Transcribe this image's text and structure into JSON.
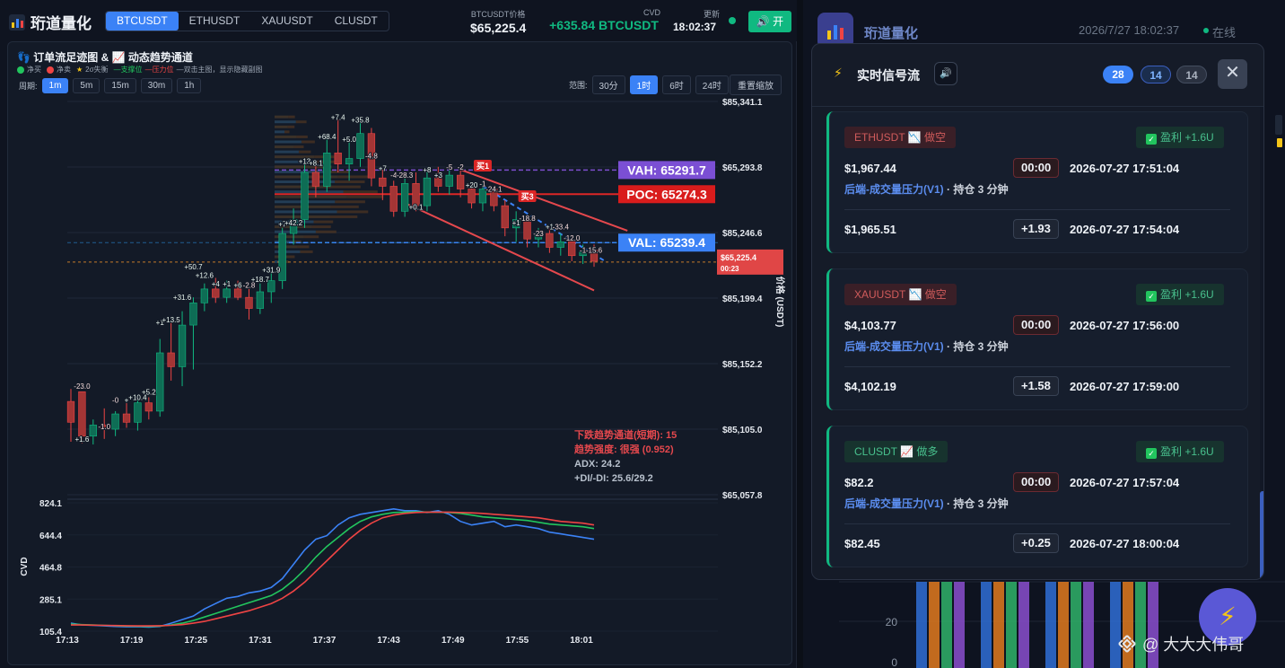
{
  "app": {
    "brand": "珩道量化",
    "symbols": [
      "BTCUSDT",
      "ETHUSDT",
      "XAUUSDT",
      "CLUSDT"
    ],
    "active_symbol": "BTCUSDT",
    "header": {
      "price_label": "BTCUSDT价格",
      "price": "$65,225.4",
      "cvd_label": "CVD",
      "cvd": "+635.84 BTCUSDT",
      "update_label": "更新",
      "update_time": "18:02:37",
      "open_label": "开"
    }
  },
  "chart_panel": {
    "title": "订单流足迹图 & 📈 动态趋势通道",
    "legend": {
      "buy": "净买",
      "sell": "净卖",
      "imbalance": "2σ失衡",
      "support": "—支撑位",
      "resistance": "—压力位",
      "hint": "—双击主图，显示隐藏副图"
    },
    "period_label": "周期:",
    "periods": [
      "1m",
      "5m",
      "15m",
      "30m",
      "1h"
    ],
    "active_period": "1m",
    "range_label": "范围:",
    "ranges": [
      "30分",
      "1时",
      "6时",
      "24时"
    ],
    "active_range": "1时",
    "reset_label": "重置缩放",
    "trend_info": {
      "line1": "下跌趋势通道(短期): 15",
      "line2": "趋势强度: 很强 (0.952)",
      "line3": "ADX: 24.2",
      "line4": "+DI/-DI: 25.6/29.2"
    }
  },
  "chart_data": [
    {
      "type": "candlestick",
      "title": "订单流足迹图",
      "ylabel": "价格 (USDT)",
      "ylim": [
        65057.8,
        65341.1
      ],
      "y_ticks": [
        "$85,341.1",
        "$65,293.8",
        "$85,246.6",
        "$85,199.4",
        "$85,152.2",
        "$85,105.0",
        "$65,057.8"
      ],
      "levels": {
        "vah": {
          "label": "VAH: 65291.7",
          "value": 65291.7,
          "color": "#7c4dcc"
        },
        "poc": {
          "label": "POC: 65274.3",
          "value": 65274.3,
          "color": "#dc2626"
        },
        "val": {
          "label": "VAL: 65239.4",
          "value": 65239.4,
          "color": "#3b82f6"
        },
        "last": {
          "label": "$65,225.4",
          "sublabel": "00:23",
          "value": 65225.4,
          "color": "#ef4444"
        }
      },
      "signals": [
        {
          "label": "买1",
          "index": 37,
          "price": 65290
        },
        {
          "label": "买3",
          "index": 41,
          "price": 65268
        }
      ],
      "footprint_labels": [
        {
          "i": 1,
          "t": "-23.0",
          "p": 65134
        },
        {
          "i": 3,
          "t": "-1.0",
          "p": 65105
        },
        {
          "i": 1,
          "t": "+1.6",
          "p": 65096
        },
        {
          "i": 4,
          "t": "-0",
          "p": 65124
        },
        {
          "i": 5,
          "t": "+",
          "p": 65124
        },
        {
          "i": 6,
          "t": "+10.4",
          "p": 65126
        },
        {
          "i": 7,
          "t": "+5.2",
          "p": 65130
        },
        {
          "i": 8,
          "t": "+1",
          "p": 65180
        },
        {
          "i": 9,
          "t": "+13.5",
          "p": 65182
        },
        {
          "i": 10,
          "t": "+31.6",
          "p": 65198
        },
        {
          "i": 11,
          "t": "+50.7",
          "p": 65220
        },
        {
          "i": 12,
          "t": "+12.6",
          "p": 65214
        },
        {
          "i": 13,
          "t": "+4",
          "p": 65208
        },
        {
          "i": 14,
          "t": "+1",
          "p": 65208
        },
        {
          "i": 15,
          "t": "+6",
          "p": 65207
        },
        {
          "i": 16,
          "t": "-2.8",
          "p": 65207
        },
        {
          "i": 17,
          "t": "+18.7",
          "p": 65211
        },
        {
          "i": 18,
          "t": "+31.9",
          "p": 65218
        },
        {
          "i": 19,
          "t": "+7",
          "p": 65251
        },
        {
          "i": 20,
          "t": "+42.2",
          "p": 65252
        },
        {
          "i": 21,
          "t": "+13",
          "p": 65296
        },
        {
          "i": 22,
          "t": "+8.1",
          "p": 65295
        },
        {
          "i": 23,
          "t": "+68.4",
          "p": 65314
        },
        {
          "i": 24,
          "t": "+7.4",
          "p": 65328
        },
        {
          "i": 25,
          "t": "+5.0",
          "p": 65312
        },
        {
          "i": 26,
          "t": "+35.8",
          "p": 65326
        },
        {
          "i": 27,
          "t": "-4.8",
          "p": 65300
        },
        {
          "i": 28,
          "t": "+7",
          "p": 65291
        },
        {
          "i": 29,
          "t": "-4",
          "p": 65286
        },
        {
          "i": 30,
          "t": "-28.3",
          "p": 65286
        },
        {
          "i": 32,
          "t": "+8",
          "p": 65290
        },
        {
          "i": 33,
          "t": "+3",
          "p": 65286
        },
        {
          "i": 34,
          "t": "-5",
          "p": 65292
        },
        {
          "i": 35,
          "t": "-2",
          "p": 65292
        },
        {
          "i": 36,
          "t": "+20",
          "p": 65279
        },
        {
          "i": 37,
          "t": "-1",
          "p": 65280
        },
        {
          "i": 38,
          "t": "-24.1",
          "p": 65276
        },
        {
          "i": 31,
          "t": "+0.1",
          "p": 65263
        },
        {
          "i": 40,
          "t": "+1",
          "p": 65252
        },
        {
          "i": 41,
          "t": "-18.8",
          "p": 65255
        },
        {
          "i": 42,
          "t": "-23",
          "p": 65244
        },
        {
          "i": 43,
          "t": "+1",
          "p": 65249
        },
        {
          "i": 44,
          "t": "-33.4",
          "p": 65249
        },
        {
          "i": 45,
          "t": "-12.0",
          "p": 65241
        },
        {
          "i": 46,
          "t": "-1",
          "p": 65232
        },
        {
          "i": 47,
          "t": "-15.6",
          "p": 65232
        }
      ],
      "x_ticks": [
        "17:13",
        "17:19",
        "17:25",
        "17:31",
        "17:37",
        "17:43",
        "17:49",
        "17:55",
        "18:01"
      ],
      "ohlc": [
        [
          65125,
          65134,
          65096,
          65110
        ],
        [
          65132,
          65128,
          65095,
          65100
        ],
        [
          65100,
          65112,
          65094,
          65108
        ],
        [
          65108,
          65120,
          65098,
          65105
        ],
        [
          65105,
          65118,
          65100,
          65116
        ],
        [
          65116,
          65124,
          65106,
          65110
        ],
        [
          65110,
          65130,
          65104,
          65124
        ],
        [
          65124,
          65128,
          65112,
          65118
        ],
        [
          65118,
          65170,
          65114,
          65160
        ],
        [
          65160,
          65182,
          65140,
          65150
        ],
        [
          65150,
          65190,
          65136,
          65180
        ],
        [
          65180,
          65200,
          65148,
          65196
        ],
        [
          65196,
          65210,
          65190,
          65206
        ],
        [
          65206,
          65214,
          65196,
          65200
        ],
        [
          65200,
          65212,
          65196,
          65206
        ],
        [
          65206,
          65212,
          65198,
          65200
        ],
        [
          65200,
          65206,
          65184,
          65192
        ],
        [
          65192,
          65210,
          65188,
          65204
        ],
        [
          65204,
          65218,
          65196,
          65212
        ],
        [
          65212,
          65250,
          65206,
          65246
        ],
        [
          65246,
          65264,
          65238,
          65256
        ],
        [
          65256,
          65296,
          65250,
          65290
        ],
        [
          65290,
          65298,
          65272,
          65280
        ],
        [
          65280,
          65314,
          65276,
          65304
        ],
        [
          65304,
          65328,
          65290,
          65296
        ],
        [
          65296,
          65312,
          65284,
          65300
        ],
        [
          65300,
          65326,
          65294,
          65318
        ],
        [
          65318,
          65322,
          65280,
          65286
        ],
        [
          65286,
          65292,
          65270,
          65280
        ],
        [
          65280,
          65284,
          65258,
          65262
        ],
        [
          65262,
          65288,
          65258,
          65282
        ],
        [
          65282,
          65290,
          65262,
          65266
        ],
        [
          65266,
          65292,
          65262,
          65286
        ],
        [
          65286,
          65294,
          65276,
          65280
        ],
        [
          65280,
          65292,
          65274,
          65288
        ],
        [
          65288,
          65292,
          65272,
          65278
        ],
        [
          65278,
          65282,
          65264,
          65268
        ],
        [
          65268,
          65284,
          65262,
          65278
        ],
        [
          65278,
          65280,
          65262,
          65266
        ],
        [
          65266,
          65270,
          65244,
          65250
        ],
        [
          65250,
          65262,
          65240,
          65256
        ],
        [
          65256,
          65258,
          65236,
          65242
        ],
        [
          65242,
          65250,
          65236,
          65246
        ],
        [
          65246,
          65250,
          65232,
          65236
        ],
        [
          65236,
          65246,
          65230,
          65240
        ],
        [
          65240,
          65244,
          65226,
          65230
        ],
        [
          65230,
          65238,
          65224,
          65234
        ],
        [
          65234,
          65238,
          65222,
          65226
        ]
      ],
      "trend_channel": {
        "upper": [
          [
            35,
            65292
          ],
          [
            50,
            65248
          ]
        ],
        "lower": [
          [
            30,
            65268
          ],
          [
            47,
            65205
          ]
        ],
        "mid": [
          [
            37,
            65280
          ],
          [
            48,
            65226
          ]
        ]
      }
    },
    {
      "type": "line",
      "title": "CVD",
      "ylabel": "CVD",
      "ylim": [
        105.4,
        824.1
      ],
      "y_ticks": [
        "824.1",
        "644.4",
        "464.8",
        "285.1",
        "105.4"
      ],
      "x_ticks": [
        "17:13",
        "17:19",
        "17:25",
        "17:31",
        "17:37",
        "17:43",
        "17:49",
        "17:55",
        "18:01"
      ],
      "series": [
        {
          "color": "#3b82f6",
          "values": [
            150,
            140,
            138,
            135,
            132,
            130,
            131,
            128,
            132,
            150,
            170,
            190,
            230,
            260,
            290,
            300,
            320,
            330,
            350,
            400,
            480,
            560,
            620,
            640,
            700,
            740,
            760,
            770,
            780,
            790,
            780,
            780,
            770,
            780,
            760,
            720,
            700,
            710,
            720,
            690,
            700,
            690,
            680,
            660,
            650,
            640,
            630,
            620
          ]
        },
        {
          "color": "#22c55e",
          "values": [
            145,
            142,
            140,
            138,
            136,
            134,
            133,
            132,
            134,
            140,
            150,
            165,
            185,
            205,
            225,
            245,
            265,
            285,
            305,
            340,
            390,
            450,
            520,
            580,
            630,
            680,
            720,
            745,
            760,
            770,
            772,
            774,
            772,
            772,
            770,
            765,
            755,
            745,
            740,
            735,
            730,
            725,
            715,
            705,
            700,
            695,
            690,
            680
          ]
        },
        {
          "color": "#ef4444",
          "values": [
            140,
            140,
            139,
            138,
            137,
            136,
            135,
            135,
            136,
            138,
            142,
            150,
            160,
            175,
            190,
            205,
            220,
            240,
            260,
            290,
            330,
            380,
            440,
            500,
            560,
            620,
            670,
            710,
            740,
            755,
            765,
            770,
            772,
            772,
            772,
            770,
            768,
            765,
            760,
            755,
            750,
            745,
            740,
            730,
            720,
            715,
            710,
            700
          ]
        }
      ]
    }
  ],
  "right_app": {
    "brand": "珩道量化",
    "datetime": "2026/7/27 18:02:37",
    "status": "在线",
    "panel_title": "实时信号流",
    "badges": {
      "total": "28",
      "win": "14",
      "loss": "14"
    },
    "signals": [
      {
        "tag": "ETHUSDT 📉 做空",
        "side": "short",
        "profit": "盈利 +1.6U",
        "entry_price": "$1,967.44",
        "duration": "00:00",
        "entry_time": "2026-07-27 17:51:04",
        "source": "后端-成交量压力(V1)",
        "hold": " · 持仓 3 分钟",
        "exit_price": "$1,965.51",
        "diff": "+1.93",
        "exit_time": "2026-07-27 17:54:04"
      },
      {
        "tag": "XAUUSDT 📉 做空",
        "side": "short",
        "profit": "盈利 +1.6U",
        "entry_price": "$4,103.77",
        "duration": "00:00",
        "entry_time": "2026-07-27 17:56:00",
        "source": "后端-成交量压力(V1)",
        "hold": " · 持仓 3 分钟",
        "exit_price": "$4,102.19",
        "diff": "+1.58",
        "exit_time": "2026-07-27 17:59:00"
      },
      {
        "tag": "CLUSDT 📈 做多",
        "side": "long",
        "profit": "盈利 +1.6U",
        "entry_price": "$82.2",
        "duration": "00:00",
        "entry_time": "2026-07-27 17:57:04",
        "source": "后端-成交量压力(V1)",
        "hold": " · 持仓 3 分钟",
        "exit_price": "$82.45",
        "diff": "+0.25",
        "exit_time": "2026-07-27 18:00:04"
      }
    ],
    "bg_chart_ticks": [
      "20",
      "0"
    ],
    "watermark": "@ 大大大伟哥"
  },
  "colors": {
    "up": "#10b981",
    "down": "#ef4444",
    "accent": "#3b82f6",
    "vah": "#7c4dcc",
    "poc": "#dc2626",
    "val": "#3b82f6"
  },
  "icons": {
    "brand": "bar-chart-icon",
    "speaker": "speaker-icon",
    "bolt": "lightning-icon",
    "close": "close-icon",
    "check": "check-icon"
  }
}
